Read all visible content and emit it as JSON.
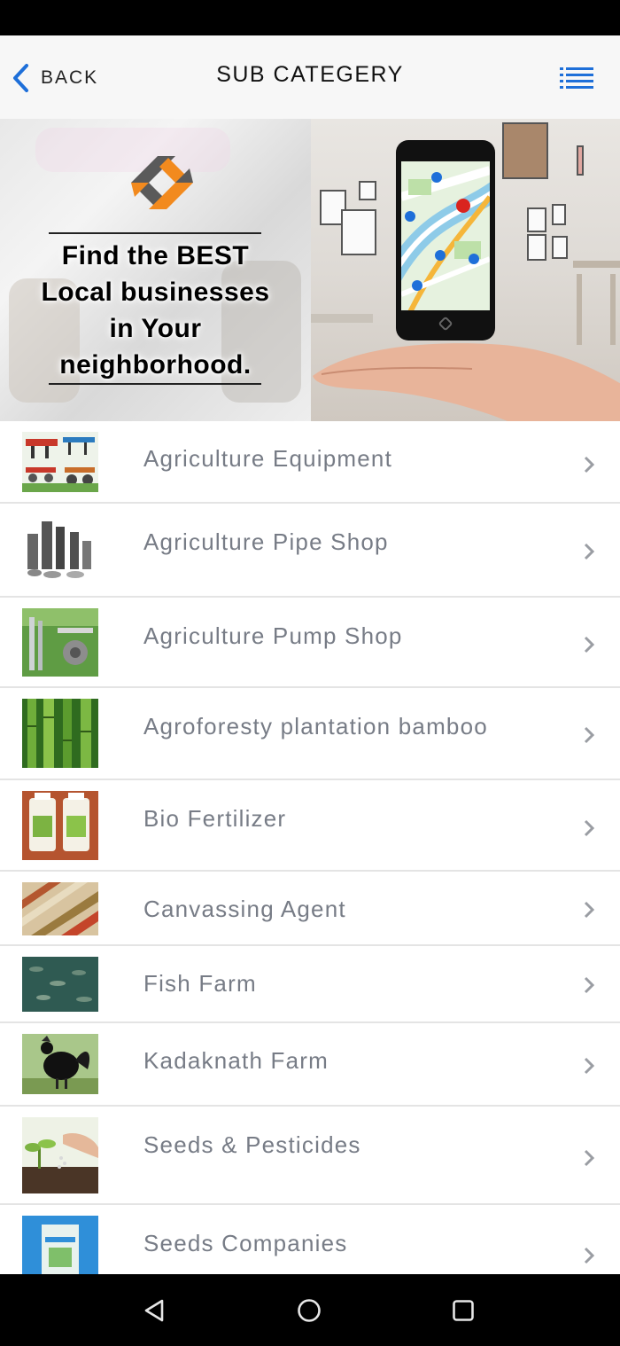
{
  "header": {
    "back_label": "BACK",
    "title": "SUB CATEGERY"
  },
  "banner": {
    "headline_lines": [
      "Find the BEST",
      "Local businesses",
      "in Your",
      "neighborhood."
    ]
  },
  "categories": [
    {
      "label": "Agriculture Equipment",
      "thumb": "farm-equipment"
    },
    {
      "label": "Agriculture Pipe Shop",
      "thumb": "pipes"
    },
    {
      "label": "Agriculture Pump Shop",
      "thumb": "pump"
    },
    {
      "label": "Agroforesty plantation bamboo",
      "thumb": "bamboo"
    },
    {
      "label": "Bio Fertilizer",
      "thumb": "fertilizer-bottles"
    },
    {
      "label": "Canvassing Agent",
      "thumb": "grains"
    },
    {
      "label": "Fish Farm",
      "thumb": "fish"
    },
    {
      "label": "Kadaknath Farm",
      "thumb": "rooster"
    },
    {
      "label": "Seeds & Pesticides",
      "thumb": "seedling"
    },
    {
      "label": "Seeds Companies",
      "thumb": "seed-packet"
    }
  ],
  "colors": {
    "accent": "#1e6fd9",
    "label": "#777c86",
    "logo_orange": "#f28a1e",
    "logo_grey": "#5a5a5a"
  }
}
